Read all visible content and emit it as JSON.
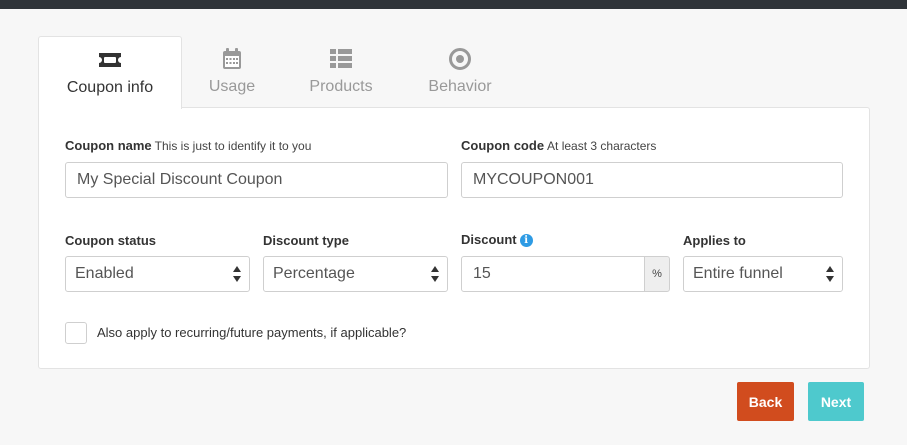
{
  "tabs": [
    {
      "label": "Coupon info",
      "icon": "ticket-icon",
      "active": true
    },
    {
      "label": "Usage",
      "icon": "calendar-icon",
      "active": false
    },
    {
      "label": "Products",
      "icon": "list-icon",
      "active": false
    },
    {
      "label": "Behavior",
      "icon": "target-icon",
      "active": false
    }
  ],
  "form": {
    "coupon_name": {
      "label": "Coupon name",
      "hint": "This is just to identify it to you",
      "value": "My Special Discount Coupon"
    },
    "coupon_code": {
      "label": "Coupon code",
      "hint": "At least 3 characters",
      "value": "MYCOUPON001"
    },
    "coupon_status": {
      "label": "Coupon status",
      "value": "Enabled"
    },
    "discount_type": {
      "label": "Discount type",
      "value": "Percentage"
    },
    "discount": {
      "label": "Discount",
      "value": "15",
      "addon": "%",
      "info": "i"
    },
    "applies_to": {
      "label": "Applies to",
      "value": "Entire funnel"
    },
    "recurring": {
      "label": "Also apply to recurring/future payments, if applicable?",
      "checked": false
    }
  },
  "actions": {
    "back": "Back",
    "next": "Next"
  },
  "colors": {
    "back": "#d14c1e",
    "next": "#4ec9cd",
    "info": "#2e9be4",
    "topbar": "#2f3439"
  }
}
